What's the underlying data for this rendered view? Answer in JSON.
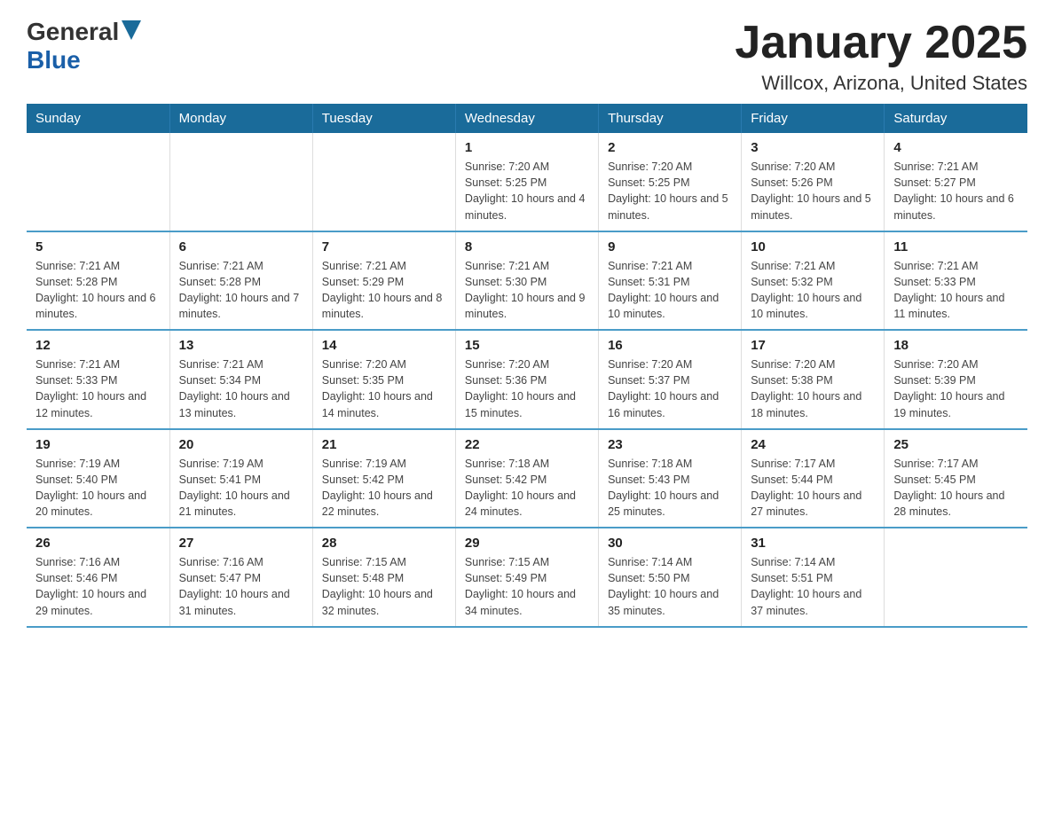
{
  "header": {
    "logo_general": "General",
    "logo_blue": "Blue",
    "title": "January 2025",
    "subtitle": "Willcox, Arizona, United States"
  },
  "days_of_week": [
    "Sunday",
    "Monday",
    "Tuesday",
    "Wednesday",
    "Thursday",
    "Friday",
    "Saturday"
  ],
  "weeks": [
    [
      {
        "day": "",
        "info": ""
      },
      {
        "day": "",
        "info": ""
      },
      {
        "day": "",
        "info": ""
      },
      {
        "day": "1",
        "info": "Sunrise: 7:20 AM\nSunset: 5:25 PM\nDaylight: 10 hours and 4 minutes."
      },
      {
        "day": "2",
        "info": "Sunrise: 7:20 AM\nSunset: 5:25 PM\nDaylight: 10 hours and 5 minutes."
      },
      {
        "day": "3",
        "info": "Sunrise: 7:20 AM\nSunset: 5:26 PM\nDaylight: 10 hours and 5 minutes."
      },
      {
        "day": "4",
        "info": "Sunrise: 7:21 AM\nSunset: 5:27 PM\nDaylight: 10 hours and 6 minutes."
      }
    ],
    [
      {
        "day": "5",
        "info": "Sunrise: 7:21 AM\nSunset: 5:28 PM\nDaylight: 10 hours and 6 minutes."
      },
      {
        "day": "6",
        "info": "Sunrise: 7:21 AM\nSunset: 5:28 PM\nDaylight: 10 hours and 7 minutes."
      },
      {
        "day": "7",
        "info": "Sunrise: 7:21 AM\nSunset: 5:29 PM\nDaylight: 10 hours and 8 minutes."
      },
      {
        "day": "8",
        "info": "Sunrise: 7:21 AM\nSunset: 5:30 PM\nDaylight: 10 hours and 9 minutes."
      },
      {
        "day": "9",
        "info": "Sunrise: 7:21 AM\nSunset: 5:31 PM\nDaylight: 10 hours and 10 minutes."
      },
      {
        "day": "10",
        "info": "Sunrise: 7:21 AM\nSunset: 5:32 PM\nDaylight: 10 hours and 10 minutes."
      },
      {
        "day": "11",
        "info": "Sunrise: 7:21 AM\nSunset: 5:33 PM\nDaylight: 10 hours and 11 minutes."
      }
    ],
    [
      {
        "day": "12",
        "info": "Sunrise: 7:21 AM\nSunset: 5:33 PM\nDaylight: 10 hours and 12 minutes."
      },
      {
        "day": "13",
        "info": "Sunrise: 7:21 AM\nSunset: 5:34 PM\nDaylight: 10 hours and 13 minutes."
      },
      {
        "day": "14",
        "info": "Sunrise: 7:20 AM\nSunset: 5:35 PM\nDaylight: 10 hours and 14 minutes."
      },
      {
        "day": "15",
        "info": "Sunrise: 7:20 AM\nSunset: 5:36 PM\nDaylight: 10 hours and 15 minutes."
      },
      {
        "day": "16",
        "info": "Sunrise: 7:20 AM\nSunset: 5:37 PM\nDaylight: 10 hours and 16 minutes."
      },
      {
        "day": "17",
        "info": "Sunrise: 7:20 AM\nSunset: 5:38 PM\nDaylight: 10 hours and 18 minutes."
      },
      {
        "day": "18",
        "info": "Sunrise: 7:20 AM\nSunset: 5:39 PM\nDaylight: 10 hours and 19 minutes."
      }
    ],
    [
      {
        "day": "19",
        "info": "Sunrise: 7:19 AM\nSunset: 5:40 PM\nDaylight: 10 hours and 20 minutes."
      },
      {
        "day": "20",
        "info": "Sunrise: 7:19 AM\nSunset: 5:41 PM\nDaylight: 10 hours and 21 minutes."
      },
      {
        "day": "21",
        "info": "Sunrise: 7:19 AM\nSunset: 5:42 PM\nDaylight: 10 hours and 22 minutes."
      },
      {
        "day": "22",
        "info": "Sunrise: 7:18 AM\nSunset: 5:42 PM\nDaylight: 10 hours and 24 minutes."
      },
      {
        "day": "23",
        "info": "Sunrise: 7:18 AM\nSunset: 5:43 PM\nDaylight: 10 hours and 25 minutes."
      },
      {
        "day": "24",
        "info": "Sunrise: 7:17 AM\nSunset: 5:44 PM\nDaylight: 10 hours and 27 minutes."
      },
      {
        "day": "25",
        "info": "Sunrise: 7:17 AM\nSunset: 5:45 PM\nDaylight: 10 hours and 28 minutes."
      }
    ],
    [
      {
        "day": "26",
        "info": "Sunrise: 7:16 AM\nSunset: 5:46 PM\nDaylight: 10 hours and 29 minutes."
      },
      {
        "day": "27",
        "info": "Sunrise: 7:16 AM\nSunset: 5:47 PM\nDaylight: 10 hours and 31 minutes."
      },
      {
        "day": "28",
        "info": "Sunrise: 7:15 AM\nSunset: 5:48 PM\nDaylight: 10 hours and 32 minutes."
      },
      {
        "day": "29",
        "info": "Sunrise: 7:15 AM\nSunset: 5:49 PM\nDaylight: 10 hours and 34 minutes."
      },
      {
        "day": "30",
        "info": "Sunrise: 7:14 AM\nSunset: 5:50 PM\nDaylight: 10 hours and 35 minutes."
      },
      {
        "day": "31",
        "info": "Sunrise: 7:14 AM\nSunset: 5:51 PM\nDaylight: 10 hours and 37 minutes."
      },
      {
        "day": "",
        "info": ""
      }
    ]
  ]
}
